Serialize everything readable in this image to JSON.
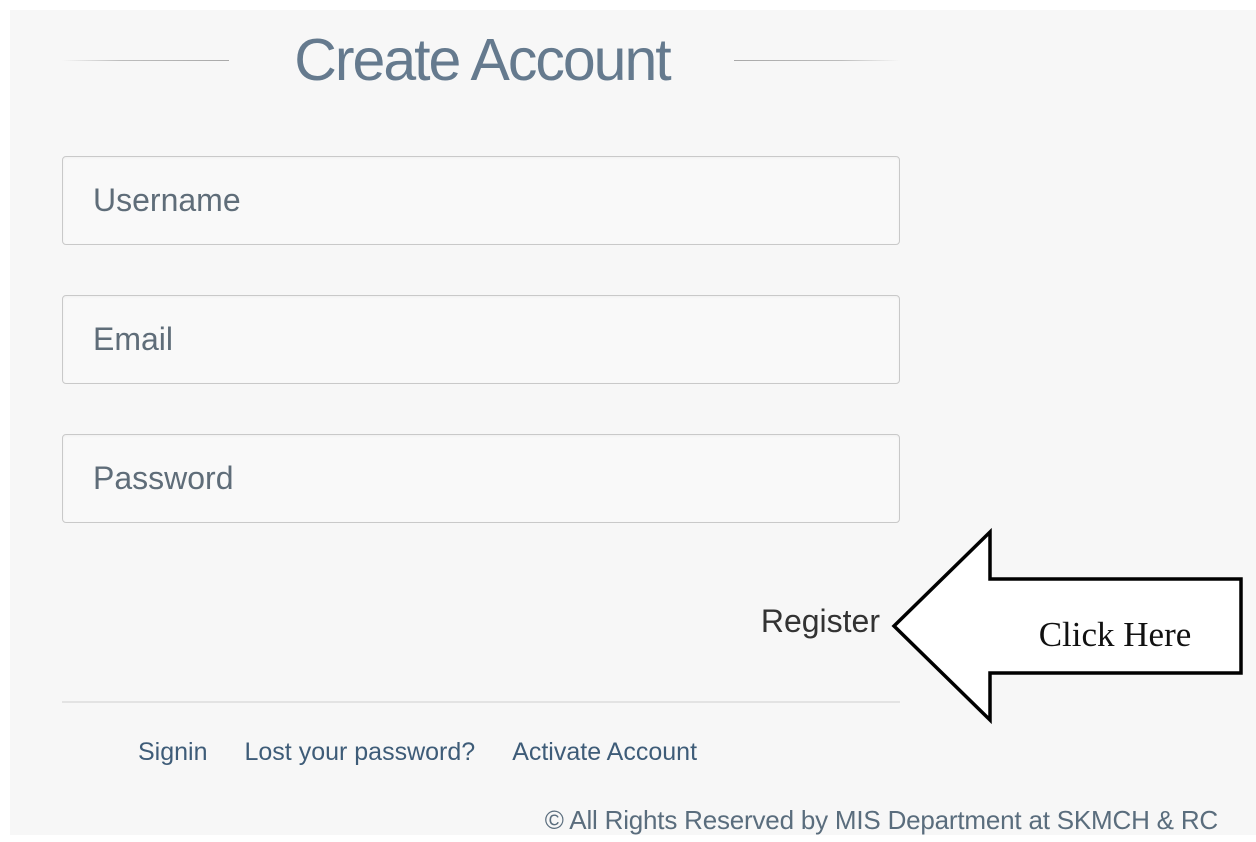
{
  "heading": {
    "title": "Create Account"
  },
  "form": {
    "username_placeholder": "Username",
    "email_placeholder": "Email",
    "password_placeholder": "Password",
    "register_label": "Register"
  },
  "footer": {
    "links": [
      {
        "label": "Signin"
      },
      {
        "label": "Lost your password?"
      },
      {
        "label": "Activate Account"
      }
    ],
    "copyright": "© All Rights Reserved by MIS Department at SKMCH & RC"
  },
  "annotation": {
    "text": "Click Here",
    "icon": "left-arrow-icon"
  },
  "colors": {
    "page": "#f7f7f7",
    "heading_text": "#657a8e",
    "field_border": "#c9c9c9",
    "link": "#3e5c78",
    "arrow_stroke": "#000000",
    "arrow_fill": "#ffffff"
  }
}
